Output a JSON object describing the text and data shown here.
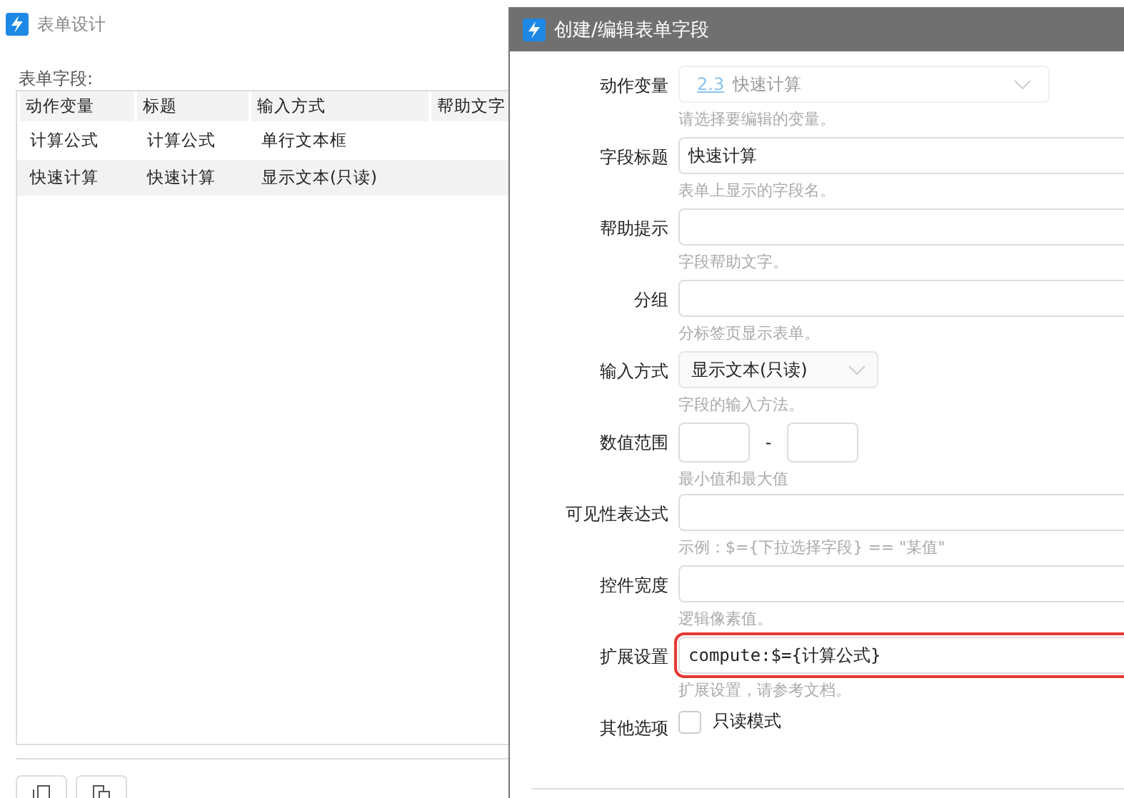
{
  "main_window": {
    "title": "表单设计",
    "fields_label": "表单字段:",
    "table": {
      "columns": [
        "动作变量",
        "标题",
        "输入方式",
        "帮助文字"
      ],
      "rows": [
        {
          "cells": [
            "计算公式",
            "计算公式",
            "单行文本框"
          ],
          "selected": false
        },
        {
          "cells": [
            "快速计算",
            "快速计算",
            "显示文本(只读)"
          ],
          "selected": true
        }
      ]
    }
  },
  "dialog": {
    "title": "创建/编辑表单字段",
    "fields": [
      {
        "kind": "select",
        "label": "动作变量",
        "index": "2.3",
        "value": "快速计算",
        "disabled": true,
        "hint": "请选择要编辑的变量。"
      },
      {
        "kind": "text",
        "label": "字段标题",
        "value": "快速计算",
        "hint": "表单上显示的字段名。"
      },
      {
        "kind": "text",
        "label": "帮助提示",
        "hint": "字段帮助文字。"
      },
      {
        "kind": "text",
        "label": "分组",
        "hint": "分标签页显示表单。"
      },
      {
        "kind": "select",
        "label": "输入方式",
        "value": "显示文本(只读)",
        "disabled": false,
        "hint": "字段的输入方法。"
      },
      {
        "kind": "range",
        "label": "数值范围",
        "separator": "-",
        "hint": "最小值和最大值"
      },
      {
        "kind": "text",
        "label": "可见性表达式",
        "hint": "示例：$={下拉选择字段} == \"某值\""
      },
      {
        "kind": "text",
        "label": "控件宽度",
        "hint": "逻辑像素值。"
      },
      {
        "kind": "text",
        "label": "扩展设置",
        "value": "compute:$={计算公式}",
        "highlighted": true,
        "hint": "扩展设置，请参考文档。"
      },
      {
        "kind": "checkbox",
        "label": "其他选项",
        "option": "只读模式",
        "checked": false
      }
    ]
  }
}
